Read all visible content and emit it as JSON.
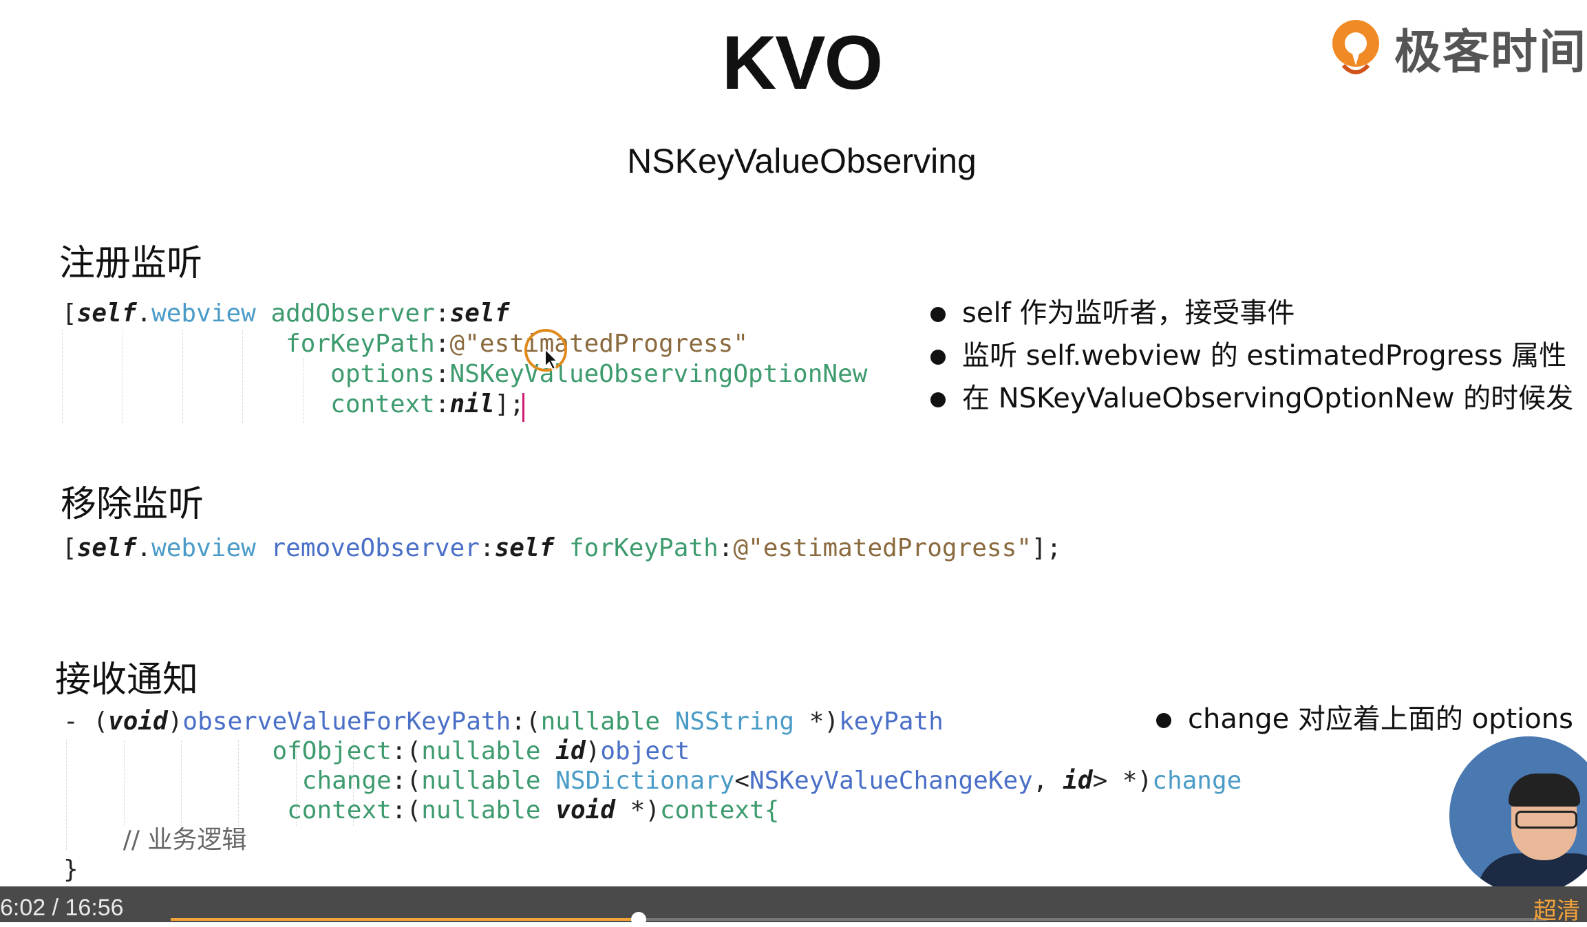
{
  "slide": {
    "title": "KVO",
    "subtitle": "NSKeyValueObserving",
    "logo_text": "极客时间"
  },
  "register": {
    "heading": "注册监听",
    "code": {
      "l1_open": "[",
      "l1_self": "self",
      "l1_dot": ".",
      "l1_prop": "webview",
      "l1_sp": " ",
      "l1_msg": "addObserver",
      "l1_colon": ":",
      "l1_arg": "self",
      "l2_label": "forKeyPath",
      "l2_colon": ":",
      "l2_str": "@\"estimatedProgress\"",
      "l3_label": "options",
      "l3_colon": ":",
      "l3_val": "NSKeyValueObservingOptionNew",
      "l4_label": "context",
      "l4_colon": ":",
      "l4_val": "nil",
      "l4_end": "];"
    },
    "bullets": [
      "self 作为监听者，接受事件",
      "监听 self.webview 的 estimatedProgress 属性",
      "在 NSKeyValueObservingOptionNew 的时候发"
    ]
  },
  "remove": {
    "heading": "移除监听",
    "code": {
      "open": "[",
      "self": "self",
      "dot": ".",
      "prop": "webview",
      "msg": "removeObserver",
      "colon1": ":",
      "arg": "self",
      "label": "forKeyPath",
      "colon2": ":",
      "str": "@\"estimatedProgress\"",
      "end": "];"
    }
  },
  "receive": {
    "heading": "接收通知",
    "code": {
      "l1_dash": "- (",
      "l1_void": "void",
      "l1_paren": ")",
      "l1_sel": "observeValueForKeyPath",
      "l1_colon": ":(",
      "l1_null": "nullable",
      "l1_type": "NSString",
      "l1_star": " *)",
      "l1_param": "keyPath",
      "l2_sel": "ofObject",
      "l2_colon": ":(",
      "l2_null": "nullable",
      "l2_id": "id",
      "l2_paren": ")",
      "l2_param": "object",
      "l3_sel": "change",
      "l3_colon": ":(",
      "l3_null": "nullable",
      "l3_type": "NSDictionary",
      "l3_lt": "<",
      "l3_key": "NSKeyValueChangeKey",
      "l3_comma": ", ",
      "l3_id": "id",
      "l3_gt": "> *)",
      "l3_param": "change",
      "l4_sel": "context",
      "l4_colon": ":(",
      "l4_null": "nullable",
      "l4_void": "void",
      "l4_star": " *)",
      "l4_param": "context",
      "l4_brace": "{",
      "l5_comment": "// 业务逻辑",
      "l6_brace": "}"
    },
    "bullet": "change 对应着上面的 options"
  },
  "player": {
    "time": "6:02 / 16:56",
    "quality": "超清",
    "progress": 0.34
  },
  "colors": {
    "accent": "#f3a33a",
    "cursor_ring": "#e08a1c",
    "caret": "#d01a72"
  }
}
